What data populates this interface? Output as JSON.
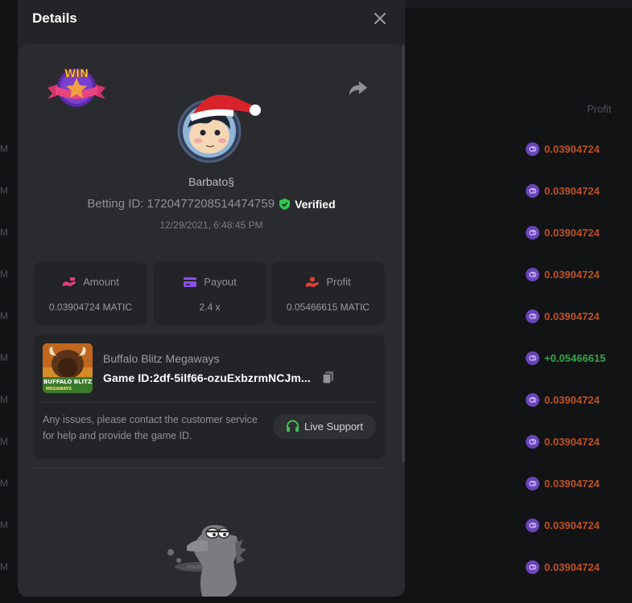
{
  "background": {
    "profit_header": "Profit",
    "rows": [
      {
        "value": "0.03904724",
        "status": "loss",
        "edge": "M"
      },
      {
        "value": "0.03904724",
        "status": "loss",
        "edge": "M"
      },
      {
        "value": "0.03904724",
        "status": "loss",
        "edge": "M"
      },
      {
        "value": "0.03904724",
        "status": "loss",
        "edge": "M"
      },
      {
        "value": "0.03904724",
        "status": "loss",
        "edge": "M"
      },
      {
        "value": "+0.05466615",
        "status": "win",
        "edge": "M"
      },
      {
        "value": "0.03904724",
        "status": "loss",
        "edge": "M"
      },
      {
        "value": "0.03904724",
        "status": "loss",
        "edge": "M"
      },
      {
        "value": "0.03904724",
        "status": "loss",
        "edge": "M"
      },
      {
        "value": "0.03904724",
        "status": "loss",
        "edge": "M"
      },
      {
        "value": "0.03904724",
        "status": "loss",
        "edge": "M"
      }
    ]
  },
  "modal": {
    "title": "Details",
    "win_badge_text": "WIN",
    "username": "Barbato§",
    "betting_id": "Betting ID: 1720477208514474759",
    "verified_label": "Verified",
    "timestamp": "12/29/2021, 6:48:45 PM",
    "stats": {
      "amount": {
        "label": "Amount",
        "value": "0.03904724 MATIC"
      },
      "payout": {
        "label": "Payout",
        "value": "2.4 x"
      },
      "profit": {
        "label": "Profit",
        "value": "0.05466615 MATIC"
      }
    },
    "game": {
      "name": "Buffalo Blitz Megaways",
      "id": "Game ID:2df-5ilf66-ozuExbzrmNCJm...",
      "thumb_text_1": "BUFFALO BLITZ",
      "thumb_text_2": "MEGAWAYS",
      "support_text": "Any issues, please contact the customer service for help and provide the game ID.",
      "support_button": "Live Support"
    }
  },
  "colors": {
    "loss": "#c0501f",
    "win": "#31a84a",
    "accent_pink": "#e0407a",
    "accent_purple": "#8e4df0",
    "accent_red": "#e0403a",
    "verified_green": "#2fc94f",
    "support_green": "#3fc14a"
  }
}
